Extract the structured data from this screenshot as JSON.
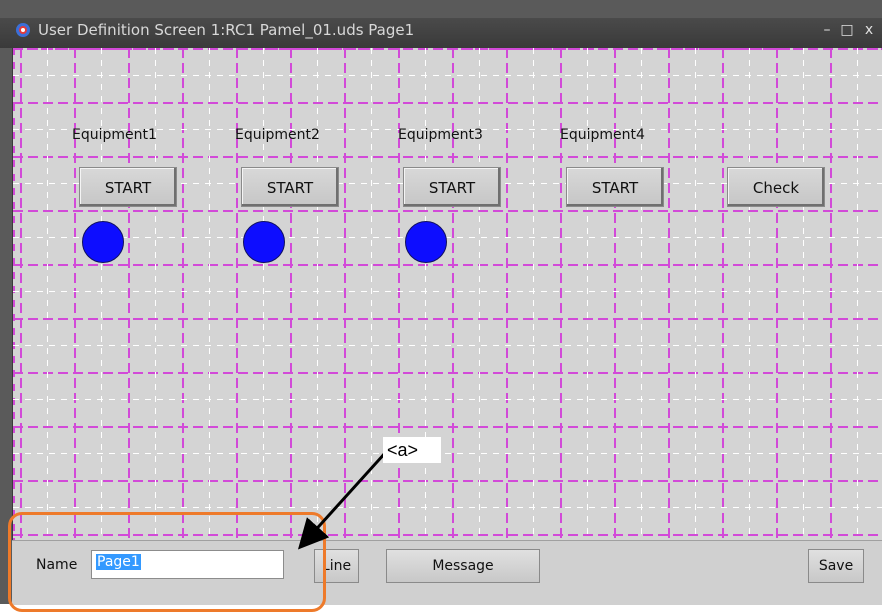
{
  "window": {
    "title": "User Definition Screen 1:RC1 Pamel_01.uds Page1",
    "minimize_glyph": "–",
    "maximize_glyph": "□",
    "close_glyph": "x"
  },
  "equipment": [
    {
      "label": "Equipment1",
      "button": "START",
      "lamp_color": "#0d0dff"
    },
    {
      "label": "Equipment2",
      "button": "START",
      "lamp_color": "#0d0dff"
    },
    {
      "label": "Equipment3",
      "button": "START",
      "lamp_color": "#0d0dff"
    },
    {
      "label": "Equipment4",
      "button": "START"
    }
  ],
  "check_button": "Check",
  "bottom": {
    "name_label": "Name",
    "name_value": "Page1",
    "line_button": "Line",
    "message_button": "Message",
    "save_button": "Save"
  },
  "annotation": {
    "callout": "<a>",
    "highlight_color": "#ee7a2a"
  },
  "colors": {
    "grid": "#d24ad8",
    "canvas": "#d4d4d4",
    "lamp": "#0d0dff"
  },
  "icons": {
    "app": "app-logo-icon"
  }
}
